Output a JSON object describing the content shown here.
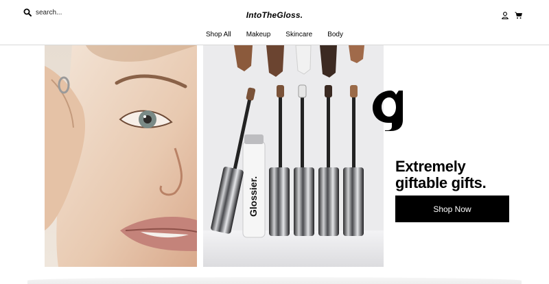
{
  "header": {
    "search_placeholder": "search...",
    "logo": "IntoTheGloss.",
    "icons": [
      "search-icon",
      "account-icon",
      "cart-icon"
    ]
  },
  "nav": {
    "items": [
      {
        "label": "Shop All"
      },
      {
        "label": "Makeup"
      },
      {
        "label": "Skincare"
      },
      {
        "label": "Body"
      }
    ]
  },
  "hero": {
    "left_image": "close-up portrait of woman's face",
    "right_image": "brow gel wands in silver tubes with product swatches",
    "product_text": "Glossier.",
    "brand_mark": "glossier-g-logo",
    "headline_line1": "Extremely",
    "headline_line2": "giftable gifts.",
    "cta_label": "Shop Now"
  },
  "colors": {
    "background": "#ffffff",
    "text": "#000000",
    "button": "#000000",
    "button_text": "#ffffff",
    "divider": "#d8d8d8"
  }
}
